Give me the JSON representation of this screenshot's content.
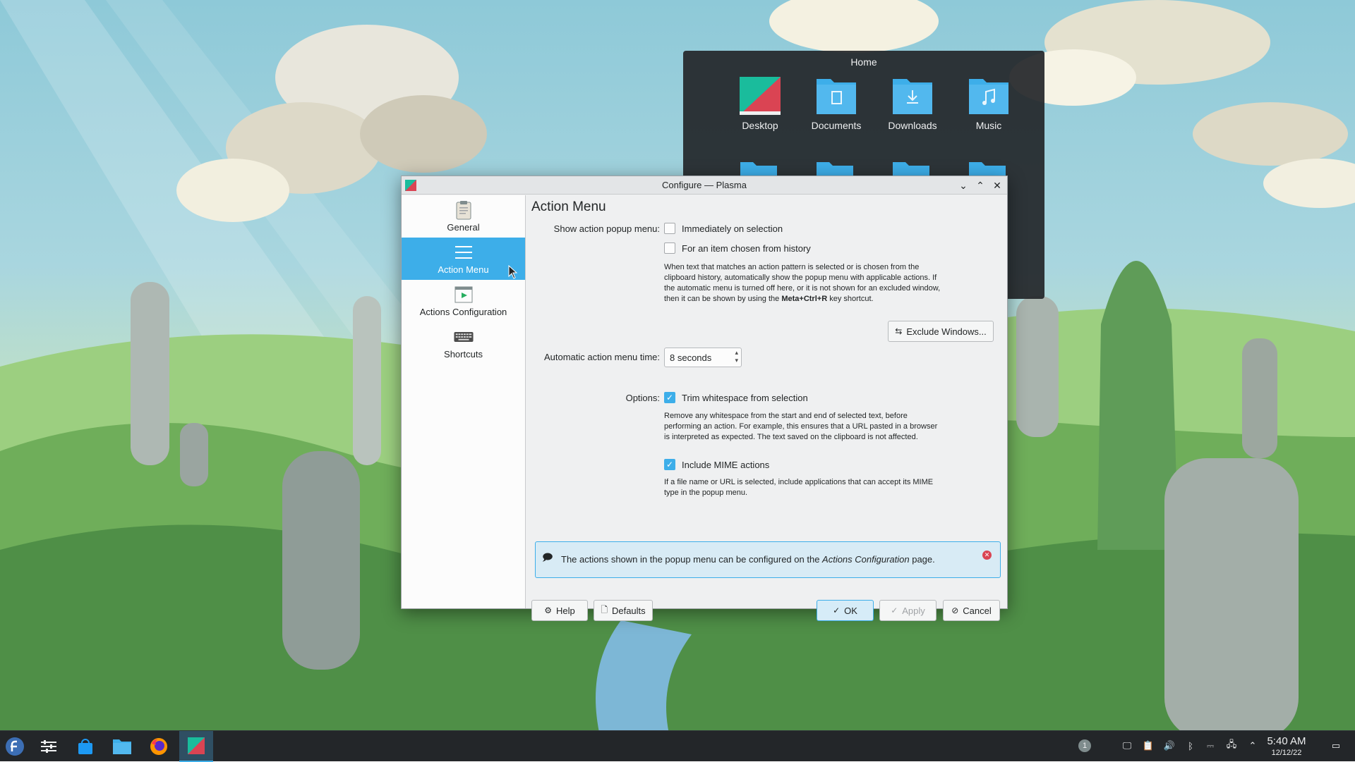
{
  "folder_widget": {
    "title": "Home",
    "items": [
      {
        "label": "Desktop",
        "icon": "desktop-folder-icon"
      },
      {
        "label": "Documents",
        "icon": "documents-folder-icon"
      },
      {
        "label": "Downloads",
        "icon": "downloads-folder-icon"
      },
      {
        "label": "Music",
        "icon": "music-folder-icon"
      }
    ]
  },
  "dialog": {
    "title": "Configure — Plasma",
    "sidebar": [
      {
        "label": "General",
        "icon": "clipboard-icon"
      },
      {
        "label": "Action Menu",
        "icon": "menu-icon",
        "active": true
      },
      {
        "label": "Actions Configuration",
        "icon": "actions-icon"
      },
      {
        "label": "Shortcuts",
        "icon": "keyboard-icon"
      }
    ],
    "page_title": "Action Menu",
    "show_popup_label": "Show action popup menu:",
    "immediately_label": "Immediately on selection",
    "immediately_checked": false,
    "history_label": "For an item chosen from history",
    "history_checked": false,
    "popup_help_1": "When text that matches an action pattern is selected or is chosen from the clipboard history, automatically show the popup menu with applicable actions. If the automatic menu is turned off here, or it is not shown for an excluded window, then it can be shown by using the ",
    "popup_help_shortcut": "Meta+Ctrl+R",
    "popup_help_2": " key shortcut.",
    "exclude_button": "Exclude Windows...",
    "menu_time_label": "Automatic action menu time:",
    "menu_time_value": "8 seconds",
    "options_label": "Options:",
    "trim_label": "Trim whitespace from selection",
    "trim_checked": true,
    "trim_help": "Remove any whitespace from the start and end of selected text, before performing an action. For example, this ensures that a URL pasted in a browser is interpreted as expected. The text saved on the clipboard is not affected.",
    "mime_label": "Include MIME actions",
    "mime_checked": true,
    "mime_help": "If a file name or URL is selected, include applications that can accept its MIME type in the popup menu.",
    "banner_pre": "The actions shown in the popup menu can be configured on the ",
    "banner_link": "Actions Configuration",
    "banner_post": " page.",
    "buttons": {
      "help": "Help",
      "defaults": "Defaults",
      "ok": "OK",
      "apply": "Apply",
      "cancel": "Cancel"
    }
  },
  "taskbar": {
    "notification_count": "1",
    "time": "5:40 AM",
    "date": "12/12/22"
  },
  "colors": {
    "accent": "#3daee9",
    "panel": "#232629",
    "window_bg": "#eff0f1"
  }
}
